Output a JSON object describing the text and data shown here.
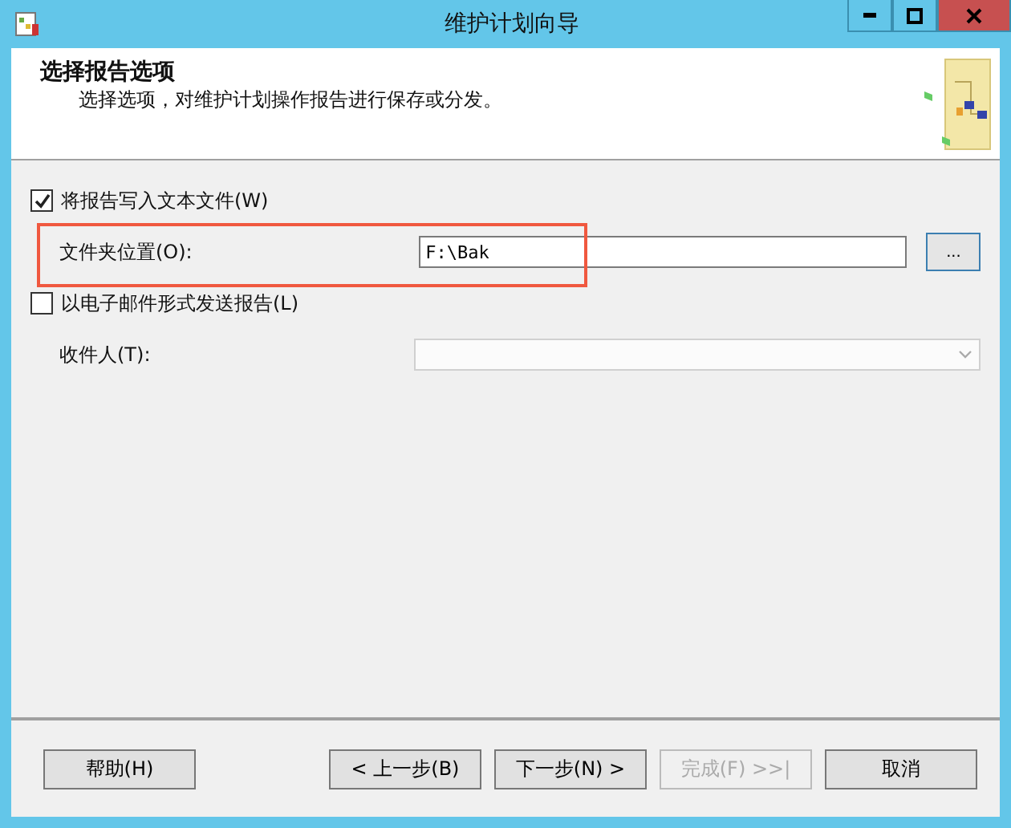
{
  "window": {
    "title": "维护计划向导"
  },
  "header": {
    "title": "选择报告选项",
    "subtitle": "选择选项，对维护计划操作报告进行保存或分发。"
  },
  "write_to_file": {
    "label": "将报告写入文本文件(W)",
    "checked": true
  },
  "folder": {
    "label": "文件夹位置(O):",
    "value": "F:\\Bak",
    "browse": "..."
  },
  "email": {
    "label": "以电子邮件形式发送报告(L)",
    "checked": false
  },
  "recipient": {
    "label": "收件人(T):",
    "disabled": true
  },
  "highlight": {
    "kind": "annotation"
  },
  "left_buttons": [
    {
      "label": "帮助(H)",
      "disabled": false
    }
  ],
  "right_buttons": [
    {
      "label": "< 上一步(B)",
      "disabled": false
    },
    {
      "label": "下一步(N) >",
      "disabled": false
    },
    {
      "label": "完成(F) >>|",
      "disabled": true
    },
    {
      "label": "取消",
      "disabled": false
    }
  ]
}
